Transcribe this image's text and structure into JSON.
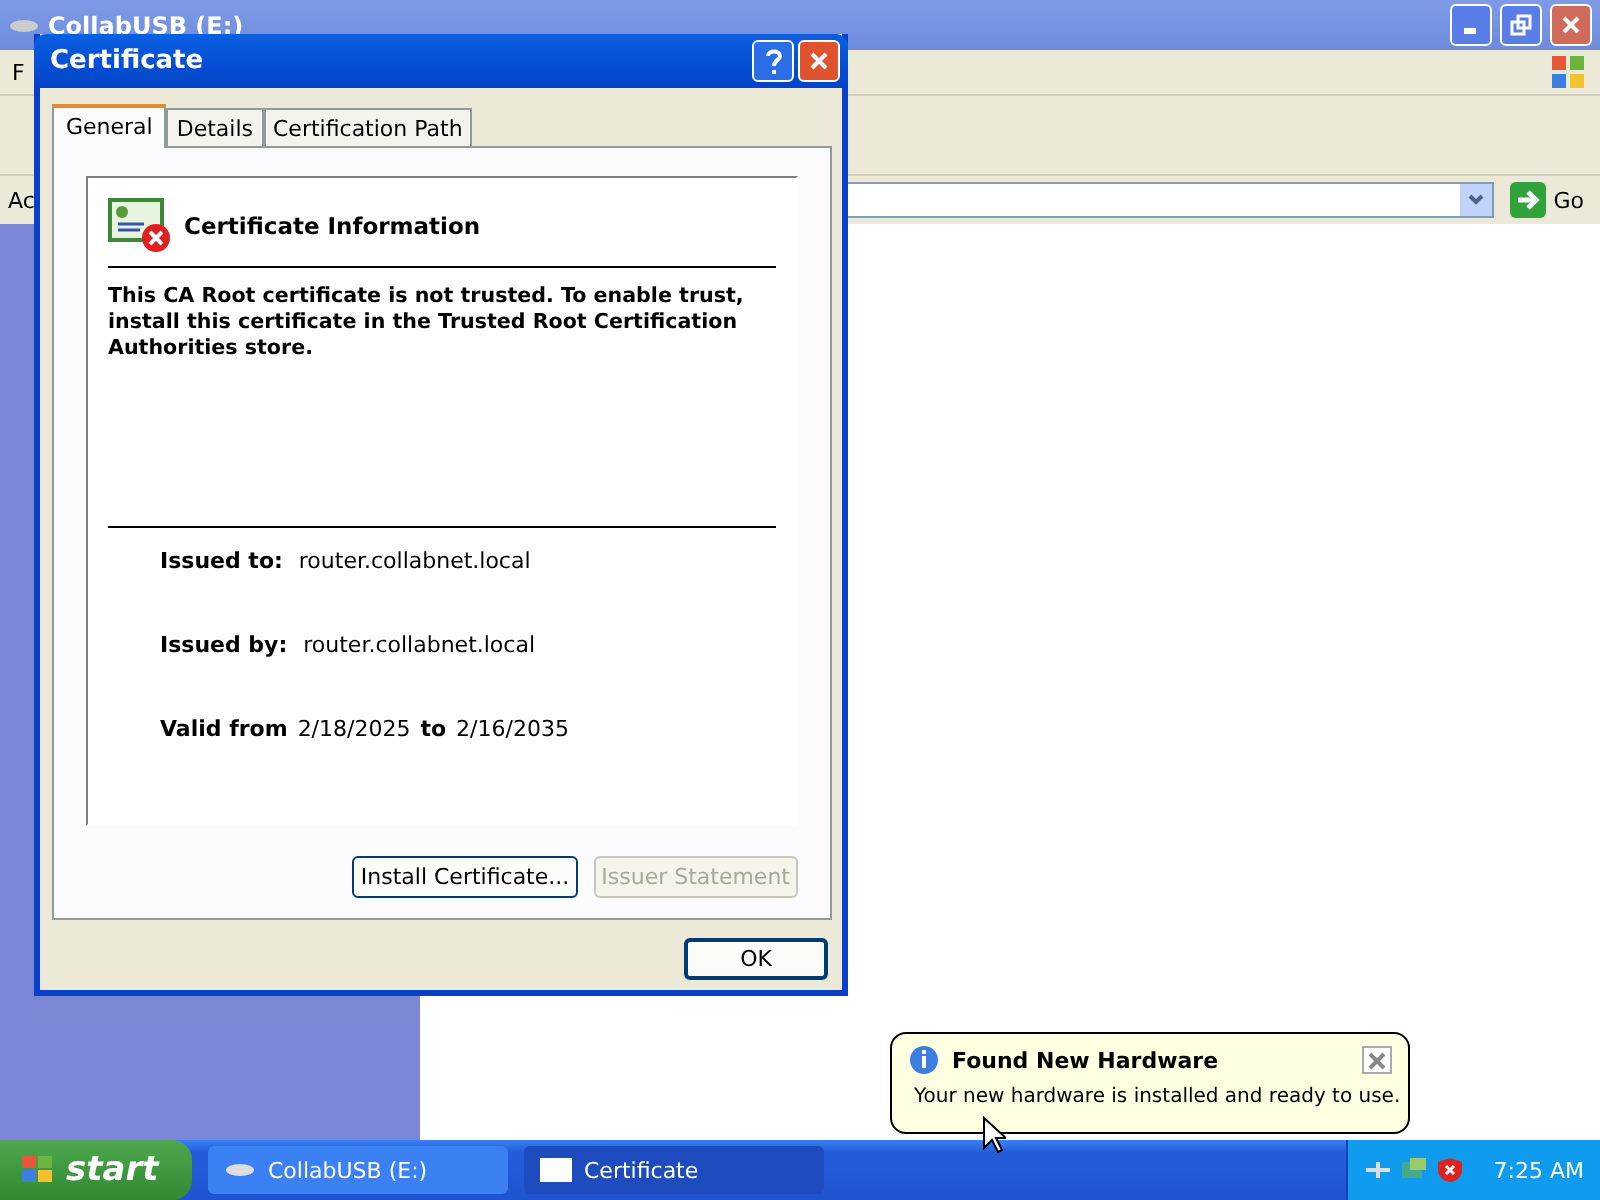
{
  "explorer": {
    "title": "CollabUSB (E:)",
    "menu_fragment": "F",
    "address_label_fragment": "Ac",
    "go_label": "Go"
  },
  "dialog": {
    "title": "Certificate",
    "tabs": [
      {
        "label": "General",
        "selected": true
      },
      {
        "label": "Details",
        "selected": false
      },
      {
        "label": "Certification Path",
        "selected": false
      }
    ],
    "heading": "Certificate Information",
    "message": "This CA Root certificate is not trusted. To enable trust, install this certificate in the Trusted Root Certification Authorities store.",
    "issued_to_label": "Issued to:",
    "issued_to": "router.collabnet.local",
    "issued_by_label": "Issued by:",
    "issued_by": "router.collabnet.local",
    "valid_from_label": "Valid from",
    "valid_from": "2/18/2025",
    "valid_to_label": "to",
    "valid_to": "2/16/2035",
    "buttons": [
      {
        "label": "Install Certificate...",
        "disabled": false
      },
      {
        "label": "Issuer Statement",
        "disabled": true
      }
    ],
    "ok": "OK"
  },
  "balloon": {
    "title": "Found New Hardware",
    "text": "Your new hardware is installed and ready to use."
  },
  "taskbar": {
    "start": "start",
    "items": [
      {
        "label": "CollabUSB (E:)",
        "kind": "drive",
        "selected": false
      },
      {
        "label": "Certificate",
        "kind": "window",
        "selected": true
      }
    ],
    "clock": "7:25 AM"
  }
}
